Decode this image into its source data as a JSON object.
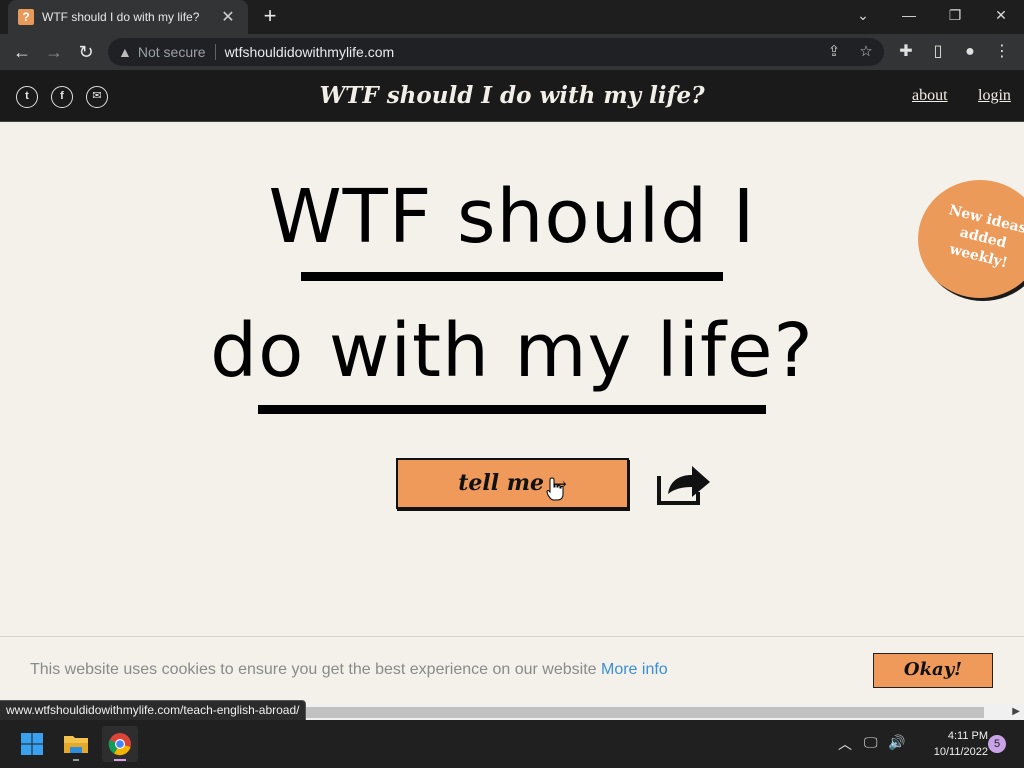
{
  "browser": {
    "tab_title": "WTF should I do with my life?",
    "favicon": "?",
    "security_label": "Not secure",
    "url": "wtfshouldidowithmylife.com",
    "status_url": "www.wtfshouldidowithmylife.com/teach-english-abroad/"
  },
  "header": {
    "title": "WTF should I do with my life?",
    "nav": {
      "about": "about",
      "login": "login"
    },
    "social_icons": [
      "twitter-icon",
      "facebook-icon",
      "email-icon"
    ]
  },
  "hero": {
    "line1": "WTF should I",
    "line2": "do with my life?",
    "button_label": "tell me",
    "button_arrow": "→",
    "badge_text": "New ideas added weekly!"
  },
  "cookie": {
    "message": "This website uses cookies to ensure you get the best experience on our website",
    "more_info": "More info",
    "okay": "Okay!"
  },
  "taskbar": {
    "time": "4:11 PM",
    "date": "10/11/2022",
    "notification_count": "5"
  },
  "colors": {
    "accent": "#ef9a5a",
    "page_bg": "#f4f1eb",
    "header_bg": "#1a1a1a",
    "link": "#3a8fd9"
  }
}
